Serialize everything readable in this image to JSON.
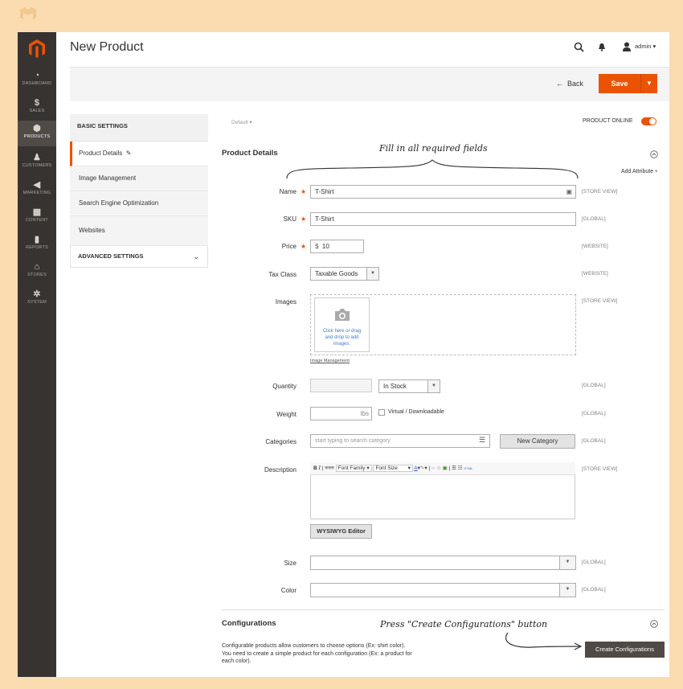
{
  "header": {
    "title": "New Product",
    "user": "admin"
  },
  "sidebar": {
    "items": [
      {
        "label": "DASHBOARD"
      },
      {
        "label": "SALES"
      },
      {
        "label": "PRODUCTS"
      },
      {
        "label": "CUSTOMERS"
      },
      {
        "label": "MARKETING"
      },
      {
        "label": "CONTENT"
      },
      {
        "label": "REPORTS"
      },
      {
        "label": "STORES"
      },
      {
        "label": "SYSTEM"
      }
    ]
  },
  "actions": {
    "back": "Back",
    "save": "Save"
  },
  "leftnav": {
    "basic": "BASIC SETTINGS",
    "items": [
      {
        "label": "Product Details"
      },
      {
        "label": "Image Management"
      },
      {
        "label": "Search Engine Optimization"
      },
      {
        "label": "Websites"
      }
    ],
    "advanced": "ADVANCED SETTINGS"
  },
  "store_switcher": "Default",
  "product_online": "PRODUCT ONLINE",
  "section_title": "Product Details",
  "add_attribute": "Add Attribute",
  "annotation_top": "Fill in all required fields",
  "annotation_bottom": "Press \"Create Configurations\" button",
  "fields": {
    "name": {
      "label": "Name",
      "value": "T-Shirt",
      "scope": "[STORE VIEW]"
    },
    "sku": {
      "label": "SKU",
      "value": "T-Shirt",
      "scope": "[GLOBAL]"
    },
    "price": {
      "label": "Price",
      "currency": "$",
      "value": "10",
      "scope": "[WEBSITE]"
    },
    "tax": {
      "label": "Tax Class",
      "value": "Taxable Goods",
      "scope": "[WEBSITE]"
    },
    "images": {
      "label": "Images",
      "upload_text": "Click here or drag and drop to add images.",
      "link": "Image Management",
      "scope": "[STORE VIEW]"
    },
    "quantity": {
      "label": "Quantity",
      "stock": "In Stock",
      "scope": "[GLOBAL]"
    },
    "weight": {
      "label": "Weight",
      "unit": "lbs",
      "virtual": "Virtual / Downloadable",
      "scope": "[GLOBAL]"
    },
    "categories": {
      "label": "Categories",
      "placeholder": "start typing to search category",
      "button": "New Category",
      "scope": "[GLOBAL]"
    },
    "description": {
      "label": "Description",
      "font_family": "Font Family",
      "font_size": "Font Size",
      "wysiwyg": "WYSIWYG Editor",
      "scope": "[STORE VIEW]"
    },
    "size": {
      "label": "Size",
      "scope": "[GLOBAL]"
    },
    "color": {
      "label": "Color",
      "scope": "[GLOBAL]"
    }
  },
  "configurations": {
    "title": "Configurations",
    "text1": "Configurable products allow customers to choose options (Ex: shirt color).",
    "text2": "You need to create a simple product for each configuration (Ex: a product for",
    "text3": "each color).",
    "button": "Create Configurations"
  },
  "colors": {
    "accent": "#eb5202",
    "sidebar": "#373330",
    "background": "#fbdcb0"
  }
}
